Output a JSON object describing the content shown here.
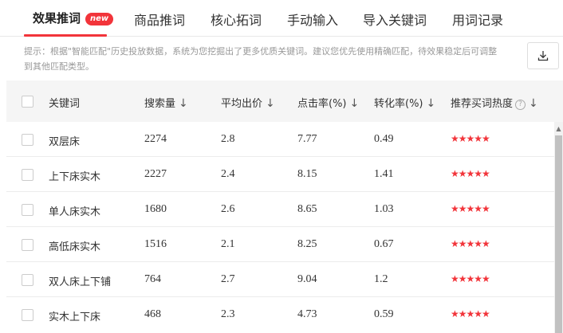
{
  "tabs": [
    {
      "label": "效果推词",
      "badge": "new"
    },
    {
      "label": "商品推词"
    },
    {
      "label": "核心拓词"
    },
    {
      "label": "手动输入"
    },
    {
      "label": "导入关键词"
    },
    {
      "label": "用词记录"
    }
  ],
  "tip": "提示：根据\"智能匹配\"历史投放数据，系统为您挖掘出了更多优质关键词。建议您优先使用精确匹配，待效果稳定后可调整到其他匹配类型。",
  "table": {
    "headers": [
      "关键词",
      "搜索量",
      "平均出价",
      "点击率(%)",
      "转化率(%)",
      "推荐买词热度"
    ],
    "sort_arrow": "↓",
    "help_icon": "?",
    "rows": [
      {
        "keyword": "双层床",
        "search": "2274",
        "bid": "2.8",
        "ctr": "7.77",
        "cvr": "0.49",
        "heat": "★★★★★"
      },
      {
        "keyword": "上下床实木",
        "search": "2227",
        "bid": "2.4",
        "ctr": "8.15",
        "cvr": "1.41",
        "heat": "★★★★★"
      },
      {
        "keyword": "单人床实木",
        "search": "1680",
        "bid": "2.6",
        "ctr": "8.65",
        "cvr": "1.03",
        "heat": "★★★★★"
      },
      {
        "keyword": "高低床实木",
        "search": "1516",
        "bid": "2.1",
        "ctr": "8.25",
        "cvr": "0.67",
        "heat": "★★★★★"
      },
      {
        "keyword": "双人床上下铺",
        "search": "764",
        "bid": "2.7",
        "ctr": "9.04",
        "cvr": "1.2",
        "heat": "★★★★★"
      },
      {
        "keyword": "实木上下床",
        "search": "468",
        "bid": "2.3",
        "ctr": "4.73",
        "cvr": "0.59",
        "heat": "★★★★★"
      }
    ]
  },
  "icons": {
    "download": "download-icon",
    "help": "help-circle-icon",
    "sort": "sort-down-arrow",
    "star": "star-icon"
  },
  "colors": {
    "accent": "#f2343a",
    "header_bg": "#f5f5f5",
    "tip_text": "#999999"
  }
}
